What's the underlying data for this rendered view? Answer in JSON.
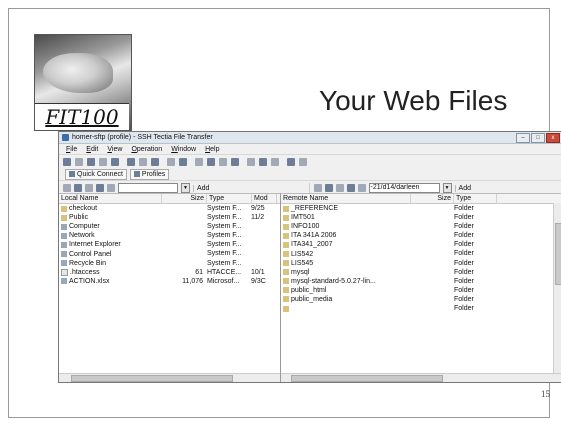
{
  "slide": {
    "logo_text": "FIT100",
    "title": "Your Web Files",
    "page_number": "15"
  },
  "window": {
    "title": "homer-sftp (profile) - SSH Tectia File Transfer",
    "menu": [
      "File",
      "Edit",
      "View",
      "Operation",
      "Window",
      "Help"
    ],
    "quick_connect_label": "Quick Connect",
    "profiles_label": "Profiles",
    "add_label": "Add",
    "remote_path": "-21/d14/darleen"
  },
  "local": {
    "headers": [
      "Local Name",
      "Size",
      "Type",
      "Mod"
    ],
    "rows": [
      {
        "name": "checkout",
        "size": "",
        "type": "System F...",
        "mod": "9/25",
        "icon": "folder-icon"
      },
      {
        "name": "Public",
        "size": "",
        "type": "System F...",
        "mod": "11/2",
        "icon": "folder-icon"
      },
      {
        "name": "Computer",
        "size": "",
        "type": "System F...",
        "mod": "",
        "icon": "computer-icon"
      },
      {
        "name": "Network",
        "size": "",
        "type": "System F...",
        "mod": "",
        "icon": "network-icon"
      },
      {
        "name": "Internet Explorer",
        "size": "",
        "type": "System F...",
        "mod": "",
        "icon": "browser-icon"
      },
      {
        "name": "Control Panel",
        "size": "",
        "type": "System F...",
        "mod": "",
        "icon": "control-panel-icon"
      },
      {
        "name": "Recycle Bin",
        "size": "",
        "type": "System F...",
        "mod": "",
        "icon": "recycle-bin-icon"
      },
      {
        "name": ".htaccess",
        "size": "61",
        "type": "HTACCE...",
        "mod": "10/1",
        "icon": "file-icon"
      },
      {
        "name": "ACTION.xlsx",
        "size": "11,076",
        "type": "Microsof...",
        "mod": "9/3C",
        "icon": "spreadsheet-icon"
      }
    ]
  },
  "remote": {
    "headers": [
      "Remote Name",
      "Size",
      "Type"
    ],
    "rows": [
      {
        "name": "_REFERENCE",
        "size": "",
        "type": "Folder"
      },
      {
        "name": "IMT501",
        "size": "",
        "type": "Folder"
      },
      {
        "name": "INFO100",
        "size": "",
        "type": "Folder"
      },
      {
        "name": "ITA 341A 2006",
        "size": "",
        "type": "Folder"
      },
      {
        "name": "ITA341_2007",
        "size": "",
        "type": "Folder"
      },
      {
        "name": "LIS542",
        "size": "",
        "type": "Folder"
      },
      {
        "name": "LIS545",
        "size": "",
        "type": "Folder"
      },
      {
        "name": "mysql",
        "size": "",
        "type": "Folder"
      },
      {
        "name": "mysql-standard-5.0.27-lin...",
        "size": "",
        "type": "Folder"
      },
      {
        "name": "public_html",
        "size": "",
        "type": "Folder"
      },
      {
        "name": "public_media",
        "size": "",
        "type": "Folder"
      },
      {
        "name": "",
        "size": "",
        "type": "Folder"
      }
    ]
  }
}
